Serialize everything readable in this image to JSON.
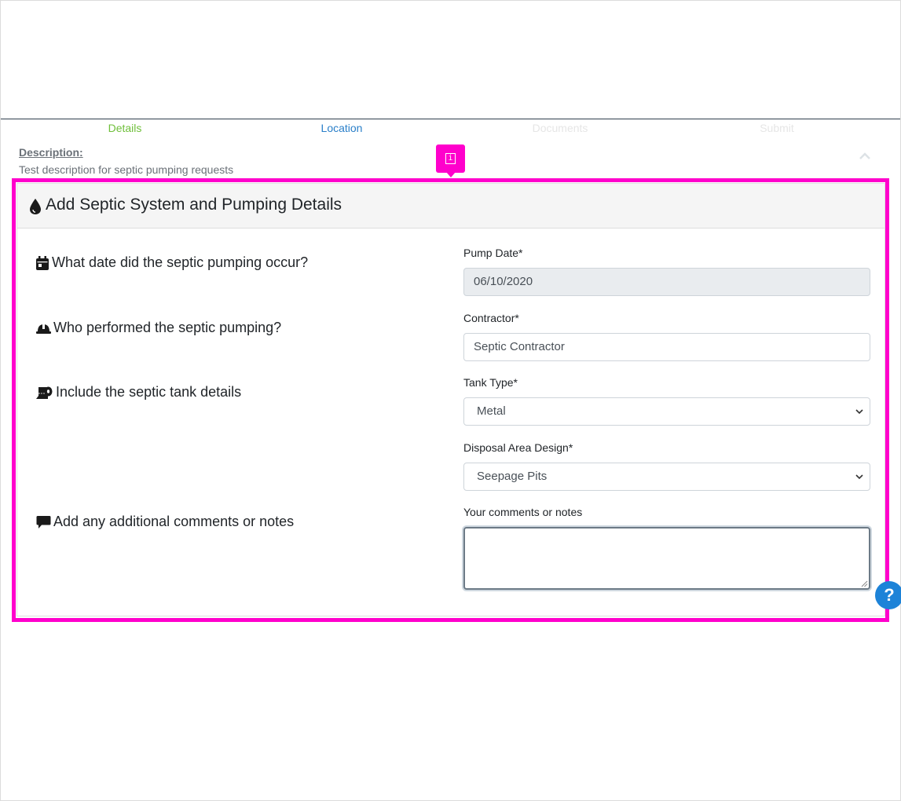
{
  "steps": [
    {
      "label": "Details",
      "color": "#6fbf3a"
    },
    {
      "label": "Location",
      "color": "#2a7fc9"
    },
    {
      "label": "Documents",
      "color": "#e6e6e6"
    },
    {
      "label": "Submit",
      "color": "#e6e6e6"
    }
  ],
  "description": {
    "label": "Description:",
    "text": "Test description for septic pumping requests"
  },
  "card": {
    "icon": "water-drop-icon",
    "title": "Add Septic System and Pumping Details"
  },
  "questions": [
    {
      "icon": "calendar-icon",
      "text": "What date did the septic pumping occur?"
    },
    {
      "icon": "hard-hat-icon",
      "text": "Who performed the septic pumping?"
    },
    {
      "icon": "toilet-paper-icon",
      "text": "Include the septic tank details"
    },
    {
      "icon": "comment-icon",
      "text": "Add any additional comments or notes"
    }
  ],
  "fields": {
    "pump_date": {
      "label": "Pump Date*",
      "value": "06/10/2020"
    },
    "contractor": {
      "label": "Contractor*",
      "value": "Septic Contractor"
    },
    "tank_type": {
      "label": "Tank Type*",
      "value": "Metal"
    },
    "disposal_area": {
      "label": "Disposal Area Design*",
      "value": "Seepage Pits"
    },
    "comments": {
      "label": "Your comments or notes",
      "value": ""
    }
  },
  "highlight_color": "#ff00cc",
  "help": {
    "glyph": "?",
    "icon": "question-icon"
  },
  "info_tag": {
    "glyph": "i",
    "icon": "info-icon"
  }
}
